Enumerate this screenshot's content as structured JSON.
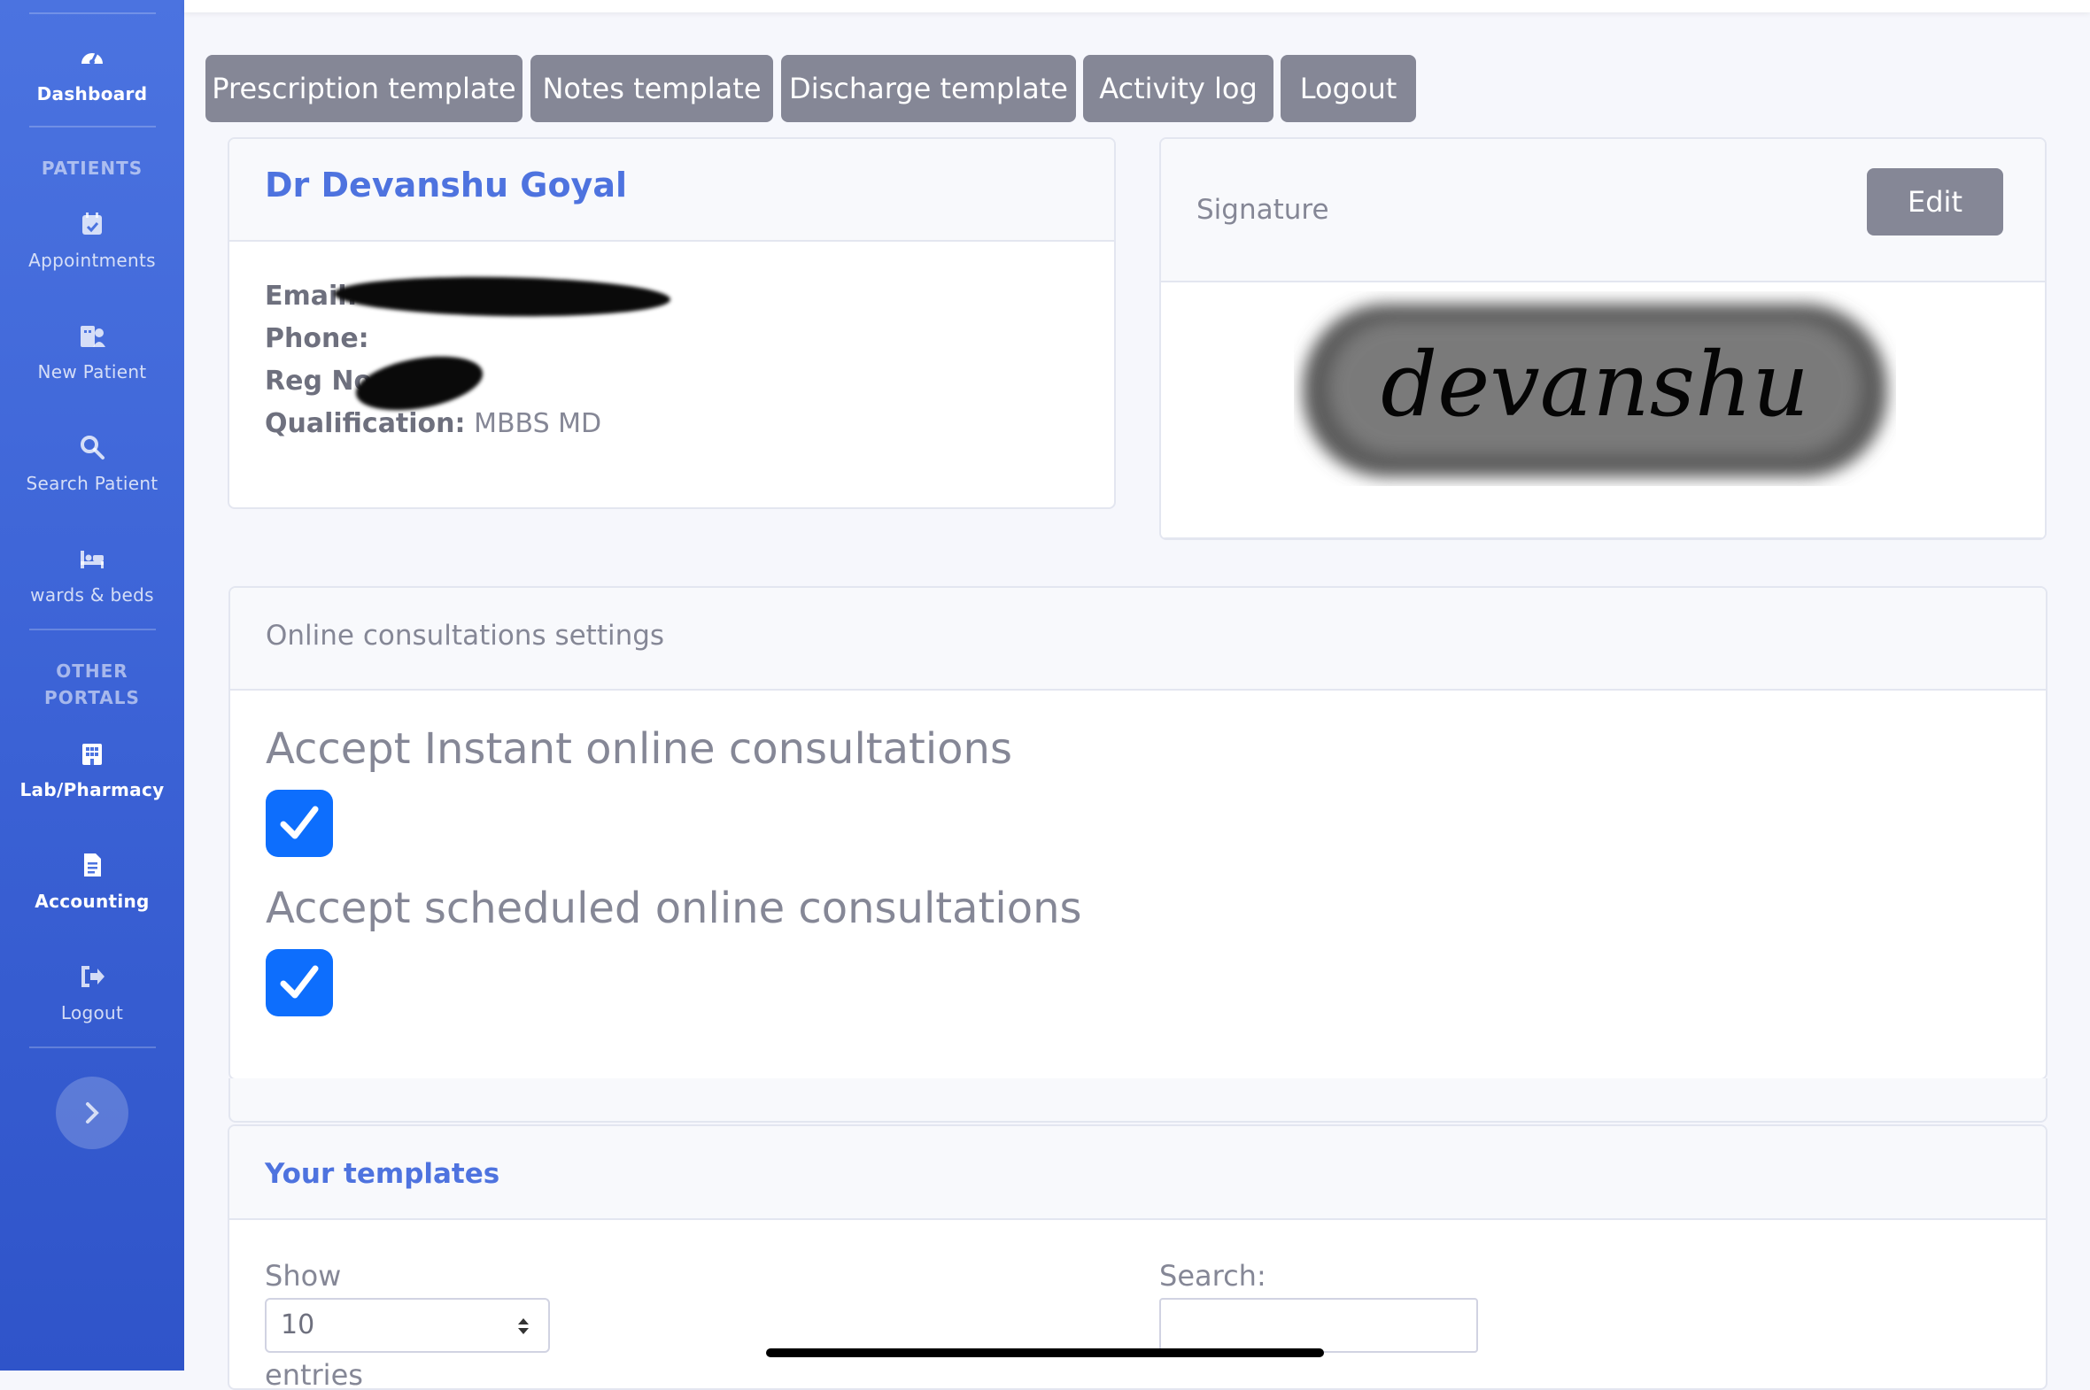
{
  "sidebar": {
    "items": [
      {
        "label": "Dashboard",
        "icon": "gauge-icon"
      },
      {
        "label": "Appointments",
        "icon": "calendar-check-icon"
      },
      {
        "label": "New Patient",
        "icon": "hospital-user-icon"
      },
      {
        "label": "Search Patient",
        "icon": "search-icon"
      },
      {
        "label": "wards & beds",
        "icon": "bed-icon"
      },
      {
        "label": "Lab/Pharmacy",
        "icon": "building-icon"
      },
      {
        "label": "Accounting",
        "icon": "file-invoice-icon"
      },
      {
        "label": "Logout",
        "icon": "sign-out-icon"
      }
    ],
    "headings": {
      "patients": "PATIENTS",
      "other_portals_line1": "OTHER",
      "other_portals_line2": "PORTALS"
    },
    "toggle_icon": "chevron-right-icon"
  },
  "toolbar": {
    "buttons": [
      "Prescription template",
      "Notes template",
      "Discharge template",
      "Activity log",
      "Logout"
    ]
  },
  "profile": {
    "name": "Dr Devanshu Goyal",
    "email_label": "Email:",
    "phone_label": "Phone:",
    "reg_label": "Reg No:",
    "qualification_label": "Qualification:",
    "qualification_value": "MBBS MD"
  },
  "signature": {
    "title": "Signature",
    "edit_label": "Edit",
    "signature_text": "devanshu"
  },
  "consultations": {
    "title": "Online consultations settings",
    "instant_label": "Accept Instant online consultations",
    "instant_checked": true,
    "scheduled_label": "Accept scheduled online consultations",
    "scheduled_checked": true
  },
  "templates": {
    "title": "Your templates",
    "show_label": "Show",
    "show_value": "10",
    "entries_label": "entries",
    "search_label": "Search:"
  },
  "colors": {
    "sidebar_top": "#4b73e0",
    "sidebar_bottom": "#2f54c9",
    "accent": "#4e73df",
    "button_gray": "#858796",
    "checkbox_blue": "#0d6efd"
  }
}
